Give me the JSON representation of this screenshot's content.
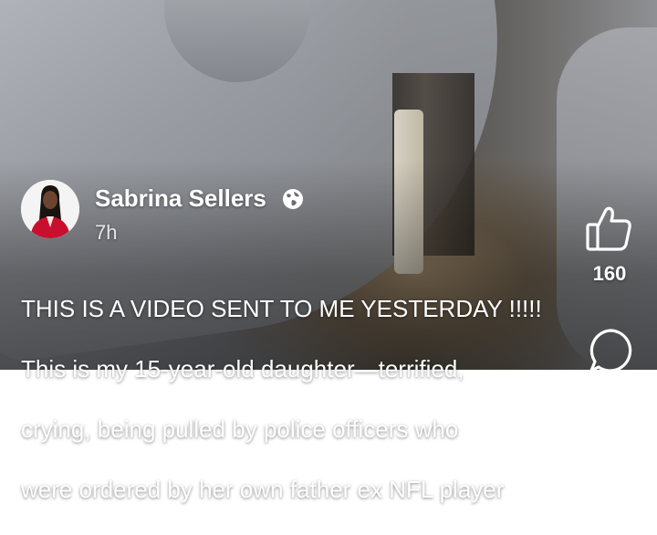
{
  "post": {
    "author_name": "Sabrina Sellers",
    "time": "7h",
    "visibility_icon": "globe-icon",
    "caption_lines": [
      "THIS IS A VIDEO SENT TO ME YESTERDAY !!!!!",
      "This is my 15-year-old daughter—terrified,",
      "crying, being pulled by police officers who",
      "were ordered by her own father ex NFL player"
    ]
  },
  "actions": {
    "like_icon": "thumbs-up-icon",
    "like_count": "160",
    "comment_icon": "comment-icon"
  },
  "colors": {
    "text": "#ffffff",
    "avatar_outfit": "#c8102e"
  }
}
